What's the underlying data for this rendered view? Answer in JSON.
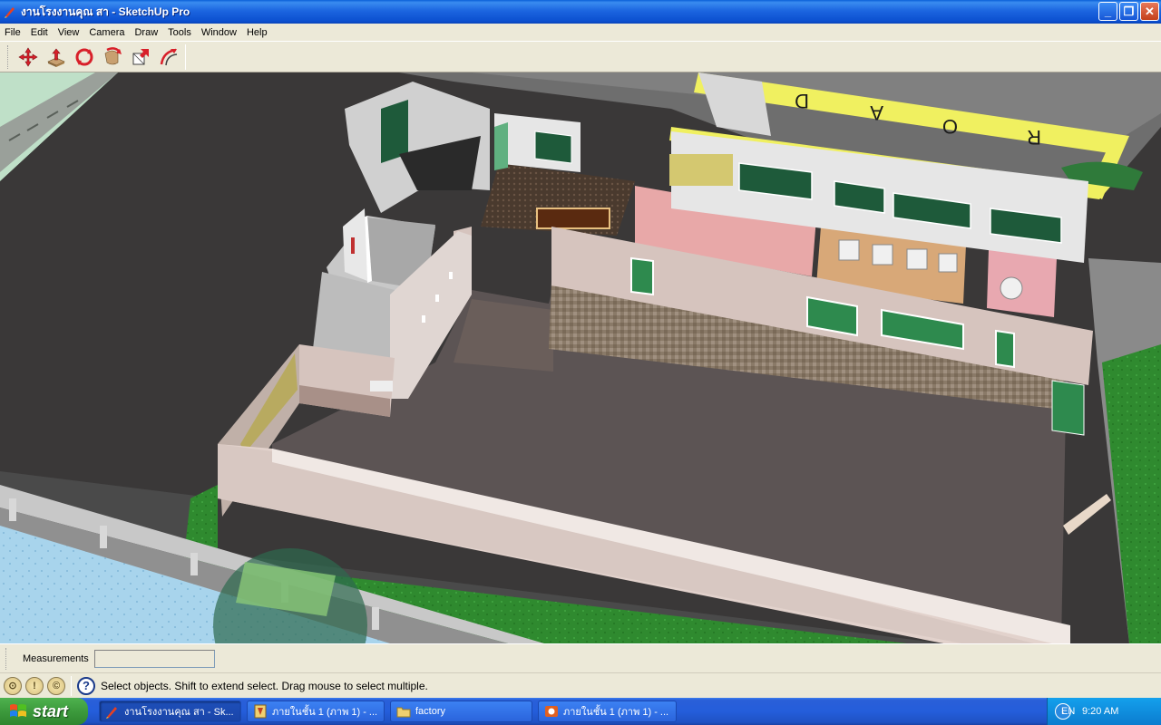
{
  "window": {
    "title": "งานโรงงานคุณ สา - SketchUp Pro",
    "minimize_glyph": "_",
    "restore_glyph": "❐",
    "close_glyph": "✕"
  },
  "menu": [
    "File",
    "Edit",
    "View",
    "Camera",
    "Draw",
    "Tools",
    "Window",
    "Help"
  ],
  "toolbar": {
    "tools": [
      "move-tool",
      "push-pull-tool",
      "rotate-tool",
      "follow-me-tool",
      "scale-tool",
      "offset-tool"
    ]
  },
  "viewport": {
    "road_letters": [
      "R",
      "O",
      "A",
      "D"
    ],
    "bg_color": "#3a3838"
  },
  "measurements": {
    "label": "Measurements",
    "value": ""
  },
  "status": {
    "help_glyph": "?",
    "text": "Select objects. Shift to extend select. Drag mouse to select multiple."
  },
  "taskbar": {
    "start_label": "start",
    "items": [
      {
        "label": "งานโรงงานคุณ สา - Sk...",
        "icon": "sketchup-icon"
      },
      {
        "label": "ภายในชั้น 1 (ภาพ 1) - ...",
        "icon": "image-editor-icon"
      },
      {
        "label": "factory",
        "icon": "folder-icon"
      },
      {
        "label": "ภายในชั้น 1 (ภาพ 1) - ...",
        "icon": "powerpoint-icon"
      }
    ],
    "lang": "EN",
    "clock": "9:20 AM"
  }
}
